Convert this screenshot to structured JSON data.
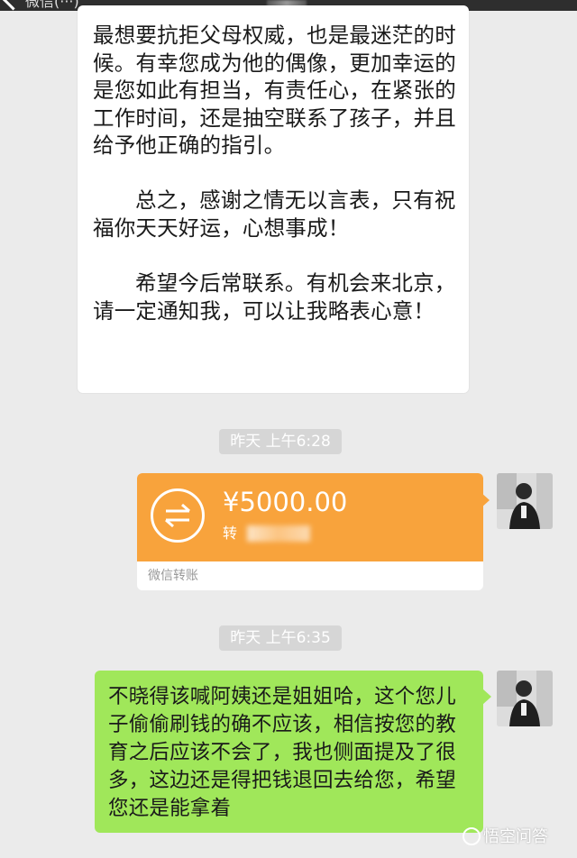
{
  "header": {
    "back_label": "微信",
    "title_suffix": "(···)"
  },
  "messages": {
    "incoming_text": {
      "paragraphs": [
        "最想要抗拒父母权威，也是最迷茫的时候。有幸您成为他的偶像，更加幸运的是您如此有担当，有责任心，在紧张的工作时间，还是抽空联系了孩子，并且给予他正确的指引。",
        "总之，感谢之情无以言表，只有祝福你天天好运，心想事成！",
        "希望今后常联系。有机会来北京，请一定通知我，可以让我略表心意！"
      ]
    },
    "timestamp_1": "昨天 上午6:28",
    "transfer": {
      "amount": "¥5000.00",
      "note": "转",
      "label": "微信转账",
      "accent_color": "#f8a33c"
    },
    "timestamp_2": "昨天 上午6:35",
    "outgoing_text": "不晓得该喊阿姨还是姐姐哈，这个您儿子偷偷刷钱的确不应该，相信按您的教育之后应该不会了，我也侧面提及了很多，这边还是得把钱退回去给您，希望您还是能拿着"
  },
  "watermark": {
    "text": "悟空问答"
  },
  "colors": {
    "background": "#ebebeb",
    "outgoing_bubble": "#a0e75a",
    "incoming_bubble": "#ffffff"
  }
}
